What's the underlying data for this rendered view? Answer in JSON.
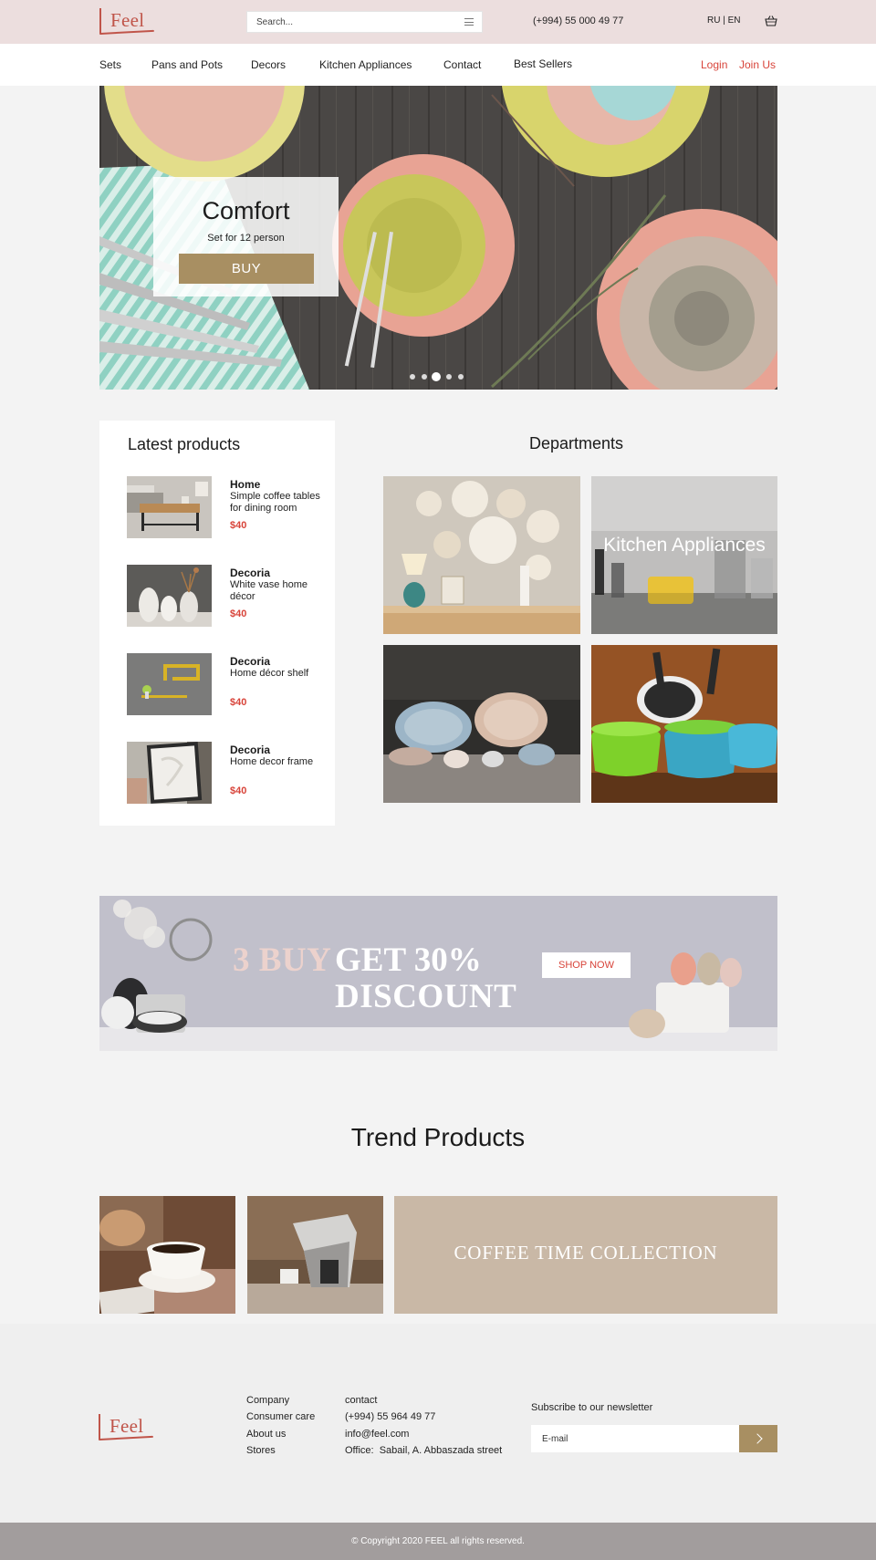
{
  "brand": {
    "logo": "Feel",
    "accent_color": "#c0554a",
    "gold": "#a88f62",
    "red": "#d8443a"
  },
  "header": {
    "search_placeholder": "Search...",
    "phone": "(+994) 55 000 49 77",
    "language": "RU | EN",
    "cart_icon": "basket-icon"
  },
  "nav": {
    "items": [
      "Sets",
      "Pans and Pots",
      "Decors",
      "Kitchen Appliances",
      "Contact",
      "Best Sellers"
    ],
    "login": "Login",
    "join": "Join Us"
  },
  "hero": {
    "title": "Comfort",
    "subtitle": "Set for 12 person",
    "button": "BUY",
    "slides": 5,
    "active_slide": 3
  },
  "latest": {
    "title": "Latest products",
    "products": [
      {
        "name": "Home",
        "desc": "Simple coffee tables for dining room",
        "price": "$40"
      },
      {
        "name": "Decoria",
        "desc": "White vase home décor",
        "price": "$40"
      },
      {
        "name": "Decoria",
        "desc": "Home décor shelf",
        "price": "$40"
      },
      {
        "name": "Decoria",
        "desc": "Home decor frame",
        "price": "$40"
      }
    ]
  },
  "departments": {
    "title": "Departments",
    "tiles": [
      {
        "label": ""
      },
      {
        "label": "Kitchen Appliances"
      },
      {
        "label": ""
      },
      {
        "label": ""
      }
    ]
  },
  "banner": {
    "part1": "3 BUY",
    "part2": "GET 30%",
    "part3": "DISCOUNT",
    "button": "SHOP NOW"
  },
  "trend": {
    "title": "Trend Products",
    "collection": "COFFEE TIME COLLECTION"
  },
  "footer": {
    "logo": "Feel",
    "links": [
      "Company",
      "Consumer care",
      "About us",
      "Stores"
    ],
    "contact": [
      "contact",
      "(+994) 55 964 49 77",
      "info@feel.com",
      "Office:  Sabail, A. Abbaszada street"
    ],
    "newsletter": "Subscribe to our newsletter",
    "email_placeholder": "E-mail",
    "copyright": "© Copyright 2020 FEEL all rights reserved."
  }
}
